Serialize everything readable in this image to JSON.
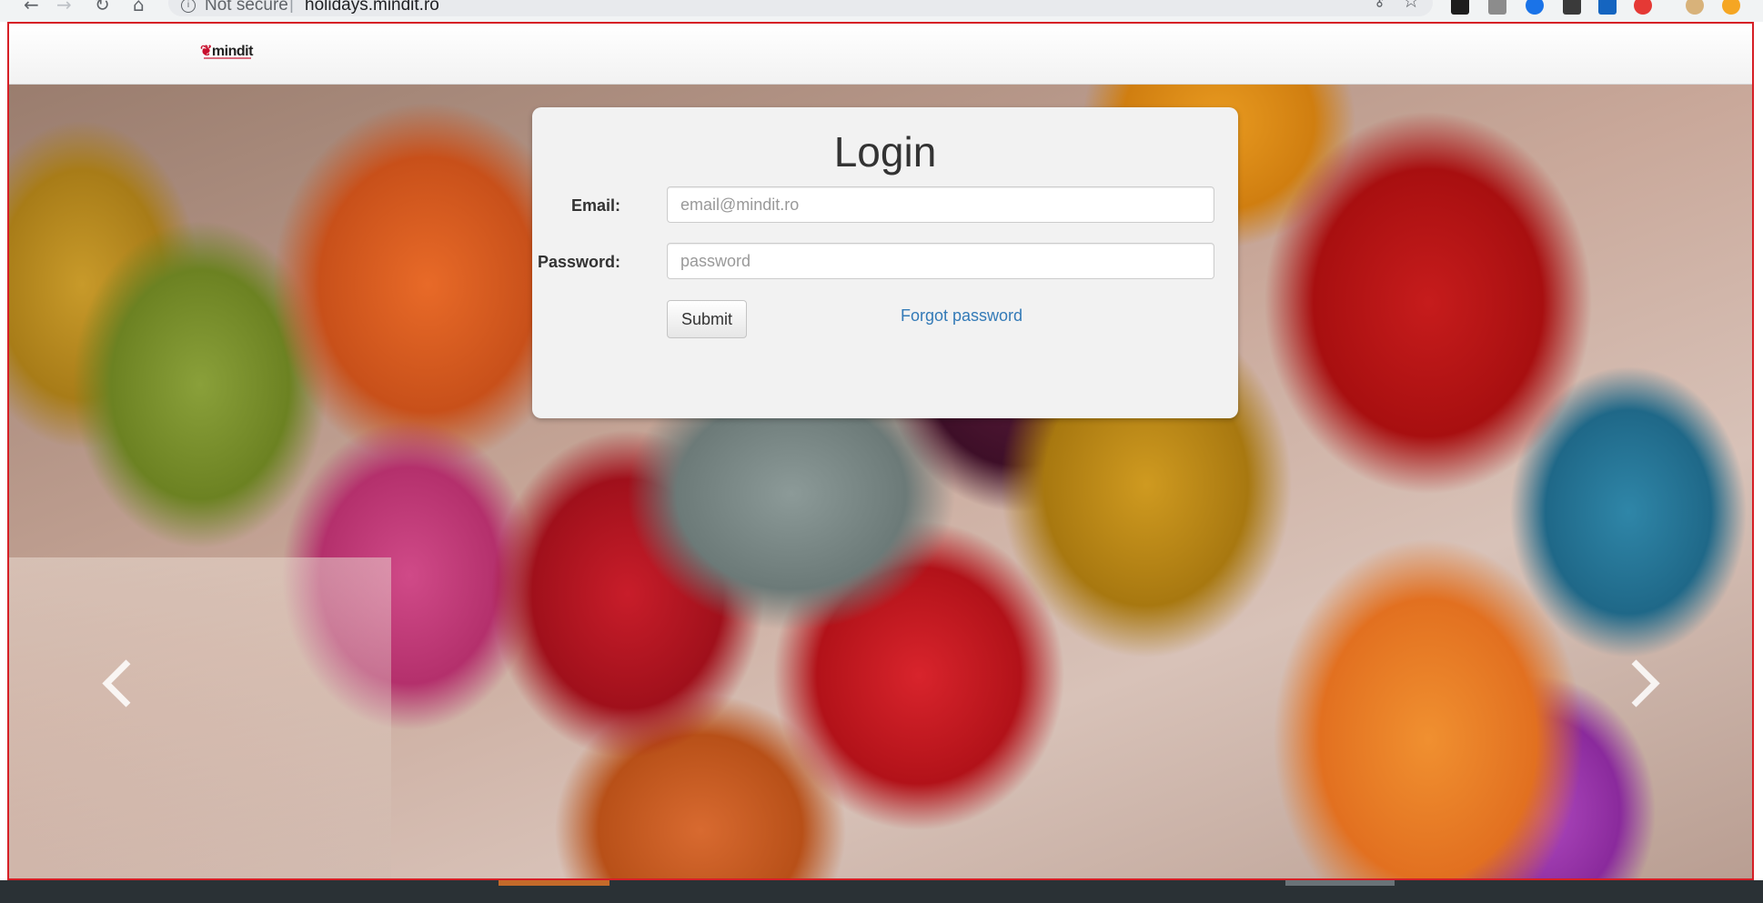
{
  "browser": {
    "security_label": "Not secure",
    "separator": "|",
    "url": "holidays.mindit.ro",
    "back_icon": "back-arrow-icon",
    "forward_icon": "forward-arrow-icon",
    "reload_icon": "reload-icon",
    "home_icon": "home-icon"
  },
  "navbar": {
    "logo_mark": "❦",
    "logo_text": "mindit"
  },
  "login": {
    "title": "Login",
    "email_label": "Email:",
    "email_placeholder": "email@mindit.ro",
    "email_value": "",
    "password_label": "Password:",
    "password_placeholder": "password",
    "password_value": "",
    "submit_label": "Submit",
    "forgot_label": "Forgot password"
  },
  "carousel": {
    "prev_icon": "chevron-left-icon",
    "next_icon": "chevron-right-icon"
  },
  "colors": {
    "frame_border": "#d61f26",
    "link": "#337ab7",
    "panel_bg": "#f2f2f2"
  }
}
